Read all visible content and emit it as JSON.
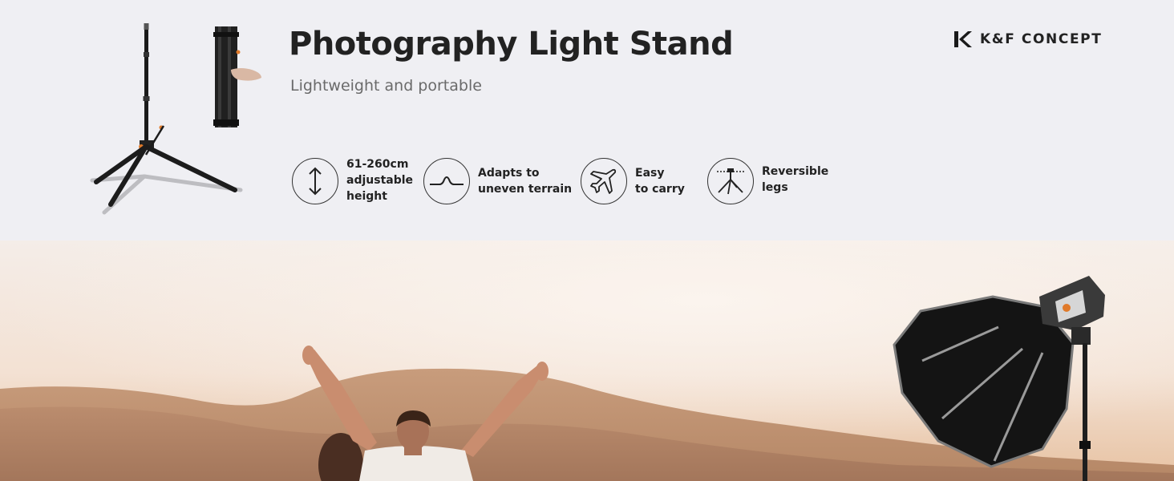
{
  "header": {
    "title": "Photography Light Stand",
    "subtitle": "Lightweight and portable"
  },
  "brand": {
    "name": "K&F CONCEPT",
    "logo_icon": "kf-logo-icon"
  },
  "features": [
    {
      "icon": "up-down-arrow-icon",
      "lines": [
        "61-260cm",
        "adjustable",
        "height"
      ]
    },
    {
      "icon": "terrain-curve-icon",
      "lines": [
        "Adapts to",
        "uneven terrain"
      ]
    },
    {
      "icon": "airplane-icon",
      "lines": [
        "Easy",
        "to carry"
      ]
    },
    {
      "icon": "tripod-legs-icon",
      "lines": [
        "Reversible",
        "legs"
      ]
    }
  ],
  "colors": {
    "background": "#efeff3",
    "text": "#222222",
    "subtitle": "#6a6a6a",
    "accent_orange": "#e07a2a"
  }
}
